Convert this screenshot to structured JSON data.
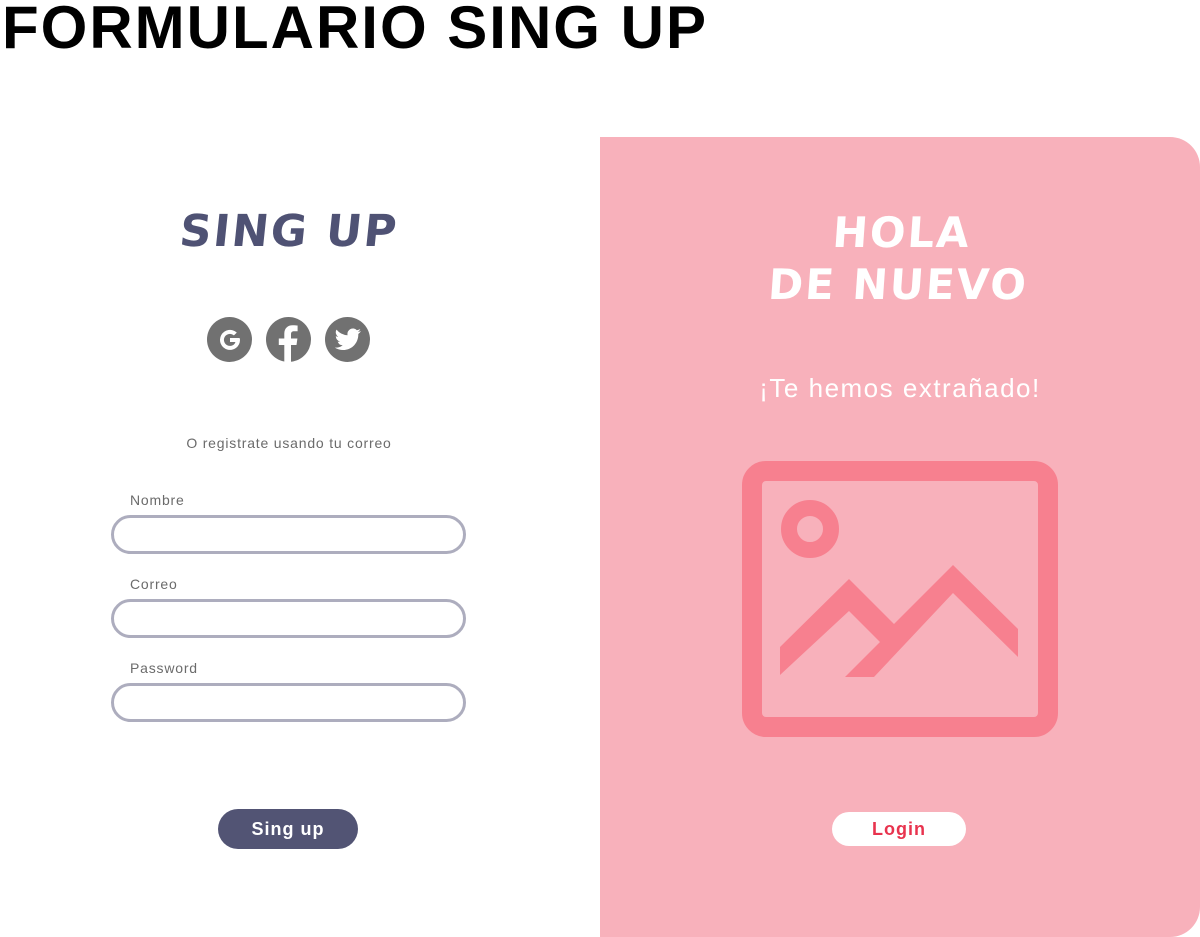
{
  "page": {
    "title": "FORMULARIO SING UP"
  },
  "signup": {
    "heading": "SING UP",
    "socials": [
      {
        "name": "google",
        "icon": "google-icon"
      },
      {
        "name": "facebook",
        "icon": "facebook-icon"
      },
      {
        "name": "twitter",
        "icon": "twitter-icon"
      }
    ],
    "email_note": "O registrate usando tu correo",
    "fields": {
      "name_label": "Nombre",
      "name_value": "",
      "email_label": "Correo",
      "email_value": "",
      "password_label": "Password",
      "password_value": ""
    },
    "button_label": "Sing up"
  },
  "welcome": {
    "heading_line1": "HOLA",
    "heading_line2": "DE NUEVO",
    "subtitle": "¡Te hemos extrañado!",
    "image_icon": "image-placeholder-icon",
    "button_label": "Login"
  },
  "colors": {
    "primary": "#525474",
    "panel_pink": "#f8b1bb",
    "accent_red": "#e8334e",
    "icon_pink": "#f7808f",
    "social_gray": "#717171",
    "input_border": "#adadbe"
  }
}
